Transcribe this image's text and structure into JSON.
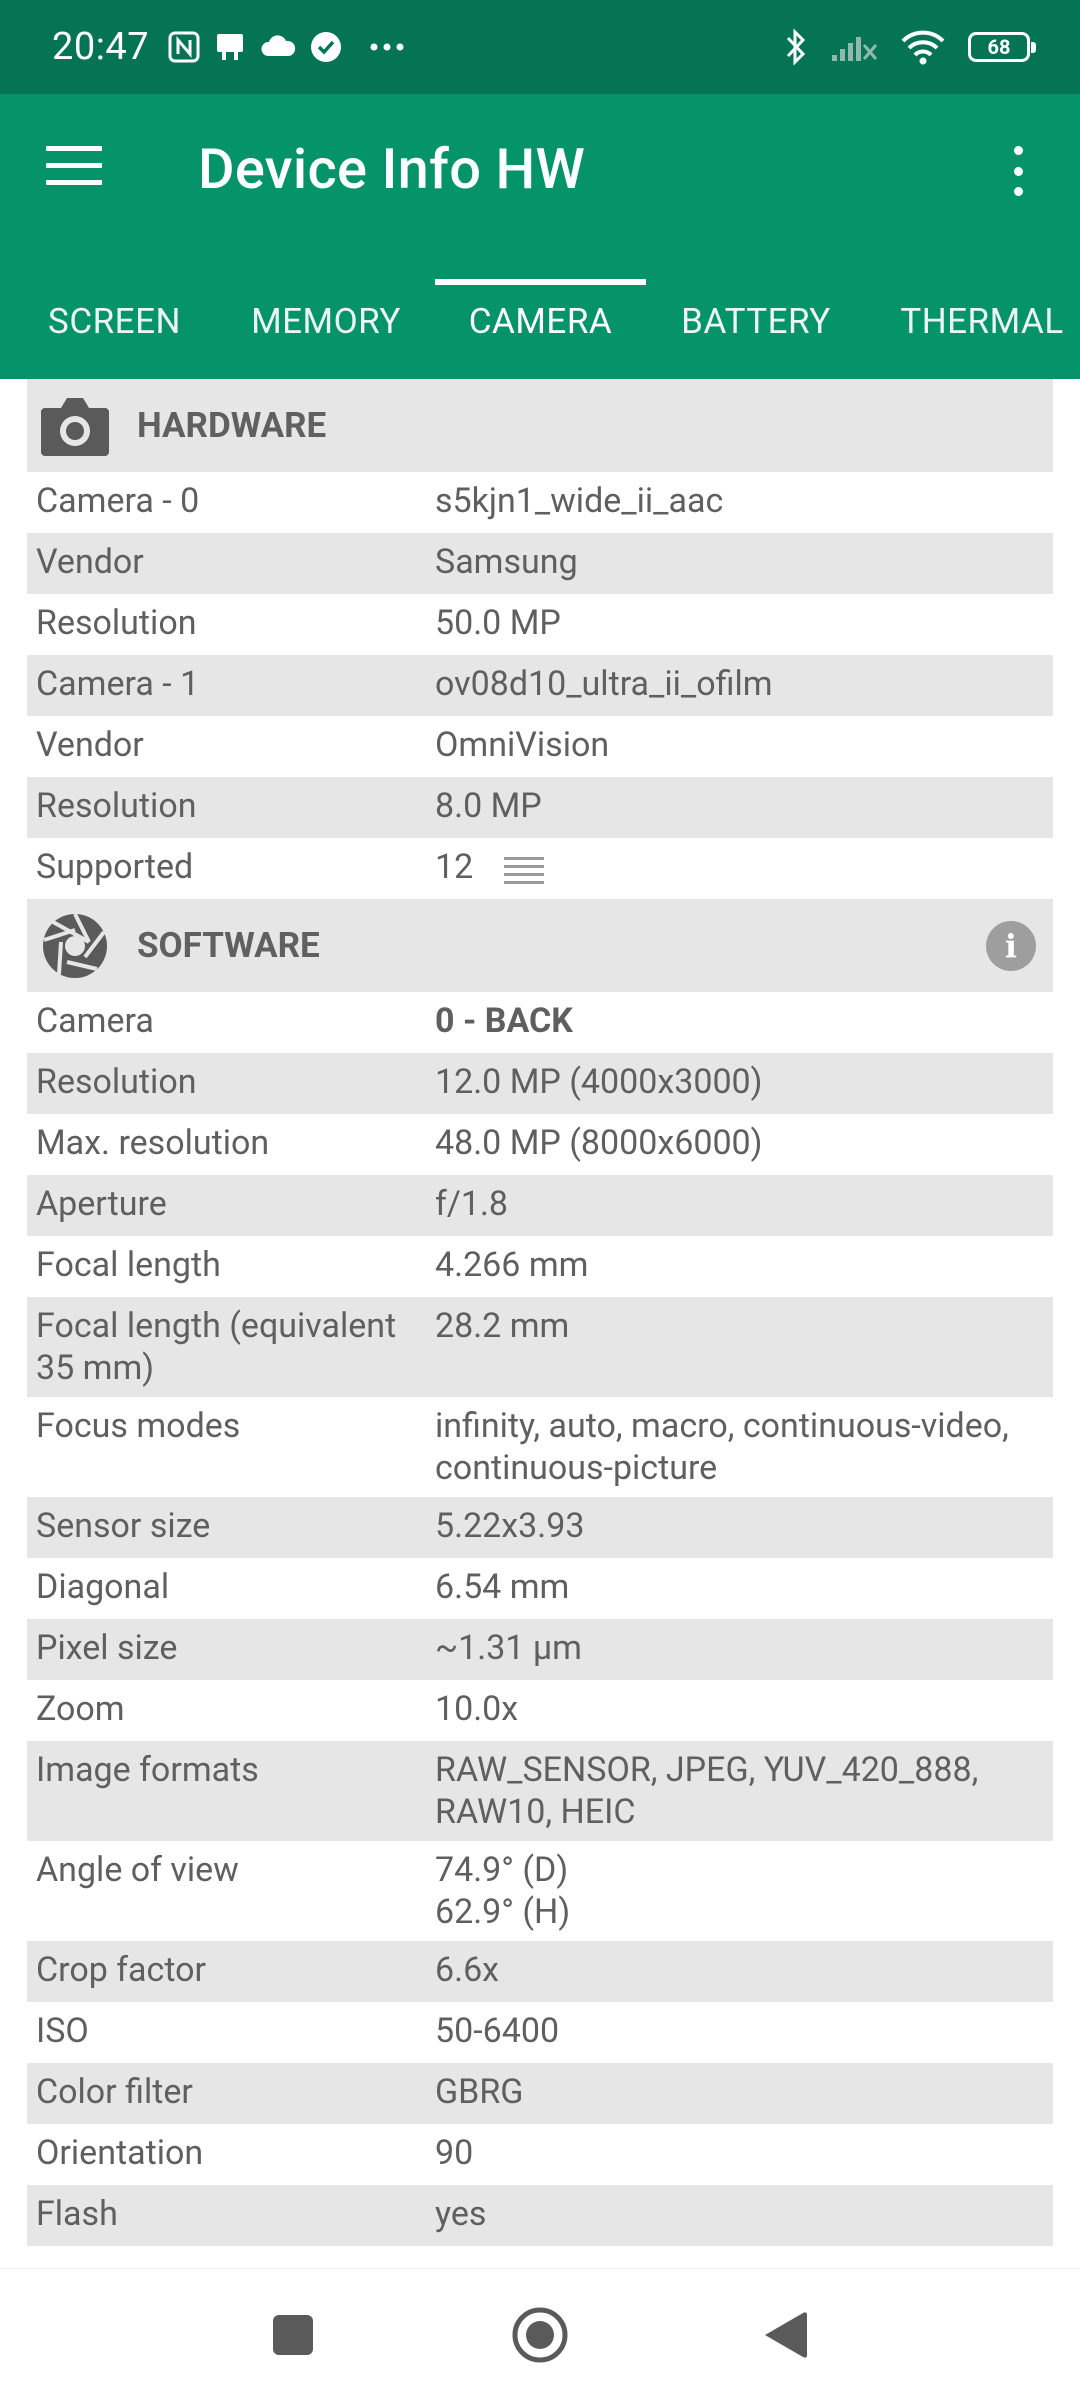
{
  "status_bar": {
    "time": "20:47",
    "left_icons": [
      "nfc-icon",
      "notification-icon",
      "cloud-icon",
      "check-circle-icon",
      "more-dots-icon"
    ],
    "right_icons": [
      "bluetooth-icon",
      "signal-off-icon",
      "wifi-icon"
    ],
    "battery": "68"
  },
  "app_bar": {
    "title": "Device Info HW"
  },
  "tabs": [
    {
      "label": "SCREEN"
    },
    {
      "label": "MEMORY"
    },
    {
      "label": "CAMERA",
      "active": true
    },
    {
      "label": "BATTERY"
    },
    {
      "label": "THERMAL"
    }
  ],
  "hardware": {
    "title": "HARDWARE",
    "rows": [
      {
        "k": "Camera - 0",
        "v": "s5kjn1_wide_ii_aac"
      },
      {
        "k": "Vendor",
        "v": "Samsung"
      },
      {
        "k": "Resolution",
        "v": "50.0 MP"
      },
      {
        "k": "Camera - 1",
        "v": "ov08d10_ultra_ii_ofilm"
      },
      {
        "k": "Vendor",
        "v": "OmniVision"
      },
      {
        "k": "Resolution",
        "v": "8.0 MP"
      },
      {
        "k": "Supported",
        "v": "12"
      }
    ]
  },
  "software": {
    "title": "SOFTWARE",
    "rows": [
      {
        "k": "Camera",
        "v": "0 - BACK"
      },
      {
        "k": "Resolution",
        "v": "12.0 MP (4000x3000)"
      },
      {
        "k": "Max. resolution",
        "v": "48.0 MP (8000x6000)"
      },
      {
        "k": "Aperture",
        "v": "f/1.8"
      },
      {
        "k": "Focal length",
        "v": "4.266 mm"
      },
      {
        "k": "Focal length (equivalent 35 mm)",
        "v": "28.2 mm"
      },
      {
        "k": "Focus modes",
        "v": "infinity, auto, macro, continuous-video, continuous-picture"
      },
      {
        "k": "Sensor size",
        "v": "5.22x3.93"
      },
      {
        "k": "Diagonal",
        "v": "6.54 mm"
      },
      {
        "k": "Pixel size",
        "v": "~1.31 µm"
      },
      {
        "k": "Zoom",
        "v": "10.0x"
      },
      {
        "k": "Image formats",
        "v": "RAW_SENSOR, JPEG, YUV_420_888, RAW10, HEIC"
      },
      {
        "k": "Angle of view",
        "v": "74.9° (D)\n62.9° (H)"
      },
      {
        "k": "Crop factor",
        "v": "6.6x"
      },
      {
        "k": "ISO",
        "v": "50-6400"
      },
      {
        "k": "Color filter",
        "v": "GBRG"
      },
      {
        "k": "Orientation",
        "v": "90"
      },
      {
        "k": "Flash",
        "v": "yes"
      }
    ]
  },
  "colors": {
    "status_bar_bg": "#057455",
    "app_bar_bg": "#05936a",
    "section_header_bg": "#e6e6e6",
    "text": "#5f5f5f"
  }
}
